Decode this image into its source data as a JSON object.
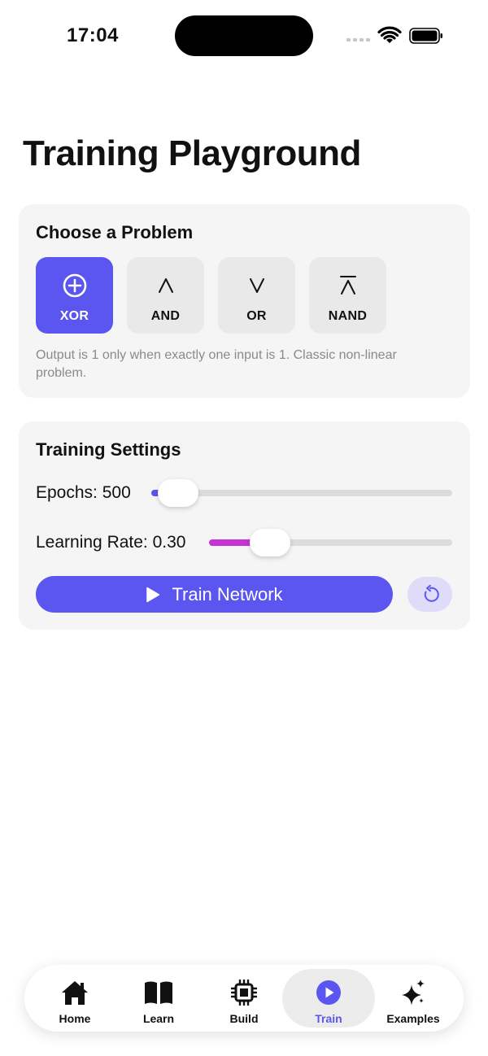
{
  "status_bar": {
    "time": "17:04"
  },
  "page": {
    "title": "Training Playground"
  },
  "problem_card": {
    "title": "Choose a Problem",
    "options": [
      {
        "label": "XOR",
        "icon": "circle-plus-icon",
        "selected": true
      },
      {
        "label": "AND",
        "icon": "logical-and-icon",
        "selected": false
      },
      {
        "label": "OR",
        "icon": "logical-or-icon",
        "selected": false
      },
      {
        "label": "NAND",
        "icon": "nand-icon",
        "selected": false
      }
    ],
    "description": "Output is 1 only when exactly one input is 1. Classic non-linear problem."
  },
  "settings_card": {
    "title": "Training Settings",
    "epochs_label": "Epochs: 500",
    "epochs_fraction": 0.09,
    "learning_rate_label": "Learning Rate: 0.30",
    "learning_rate_fraction": 0.25,
    "train_label": "Train Network",
    "reset_icon": "reset-icon"
  },
  "tab_bar": {
    "items": [
      {
        "label": "Home",
        "icon": "house-icon",
        "active": false
      },
      {
        "label": "Learn",
        "icon": "book-icon",
        "active": false
      },
      {
        "label": "Build",
        "icon": "cpu-icon",
        "active": false
      },
      {
        "label": "Train",
        "icon": "play-circle-icon",
        "active": true
      },
      {
        "label": "Examples",
        "icon": "sparkles-icon",
        "active": false
      }
    ]
  },
  "colors": {
    "accent": "#5b56ef",
    "learning_rate_fill": "#c532d8",
    "card_bg": "#f5f5f5"
  }
}
